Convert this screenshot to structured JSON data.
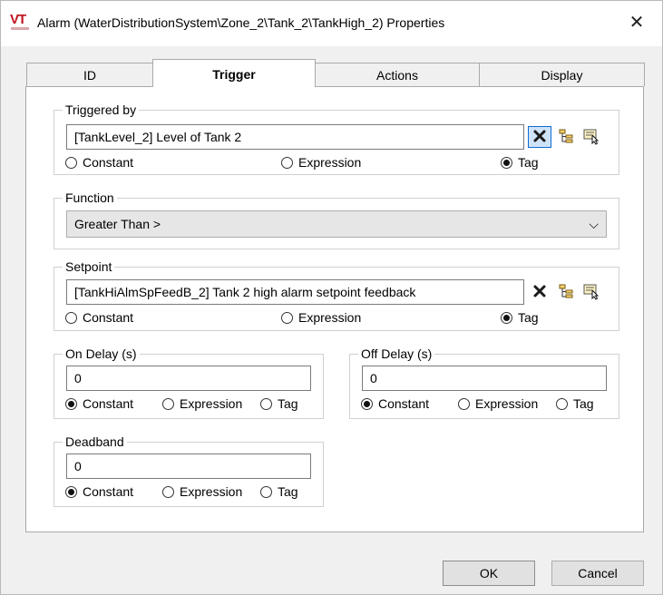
{
  "window": {
    "title": "Alarm (WaterDistributionSystem\\Zone_2\\Tank_2\\TankHigh_2) Properties",
    "logo_text": "VT",
    "close_glyph": "✕"
  },
  "tabs": [
    {
      "label": "ID",
      "active": false
    },
    {
      "label": "Trigger",
      "active": true
    },
    {
      "label": "Actions",
      "active": false
    },
    {
      "label": "Display",
      "active": false
    }
  ],
  "triggered_by": {
    "legend": "Triggered by",
    "value": "[TankLevel_2]   Level of Tank 2",
    "options": [
      "Constant",
      "Expression",
      "Tag"
    ],
    "selected": "Tag"
  },
  "function": {
    "legend": "Function",
    "value": "Greater Than >",
    "arrow": "⌵"
  },
  "setpoint": {
    "legend": "Setpoint",
    "value": "[TankHiAlmSpFeedB_2]   Tank 2 high alarm setpoint feedback",
    "options": [
      "Constant",
      "Expression",
      "Tag"
    ],
    "selected": "Tag"
  },
  "on_delay": {
    "legend": "On Delay (s)",
    "value": "0",
    "options": [
      "Constant",
      "Expression",
      "Tag"
    ],
    "selected": "Constant"
  },
  "off_delay": {
    "legend": "Off Delay (s)",
    "value": "0",
    "options": [
      "Constant",
      "Expression",
      "Tag"
    ],
    "selected": "Constant"
  },
  "deadband": {
    "legend": "Deadband",
    "value": "0",
    "options": [
      "Constant",
      "Expression",
      "Tag"
    ],
    "selected": "Constant"
  },
  "buttons": {
    "ok": "OK",
    "cancel": "Cancel"
  },
  "icons": [
    "clear-icon",
    "tag-browser-icon",
    "tag-picker-icon"
  ],
  "colors": {
    "logo_red": "#c0121e",
    "focus_blue": "#0e6ad6"
  }
}
